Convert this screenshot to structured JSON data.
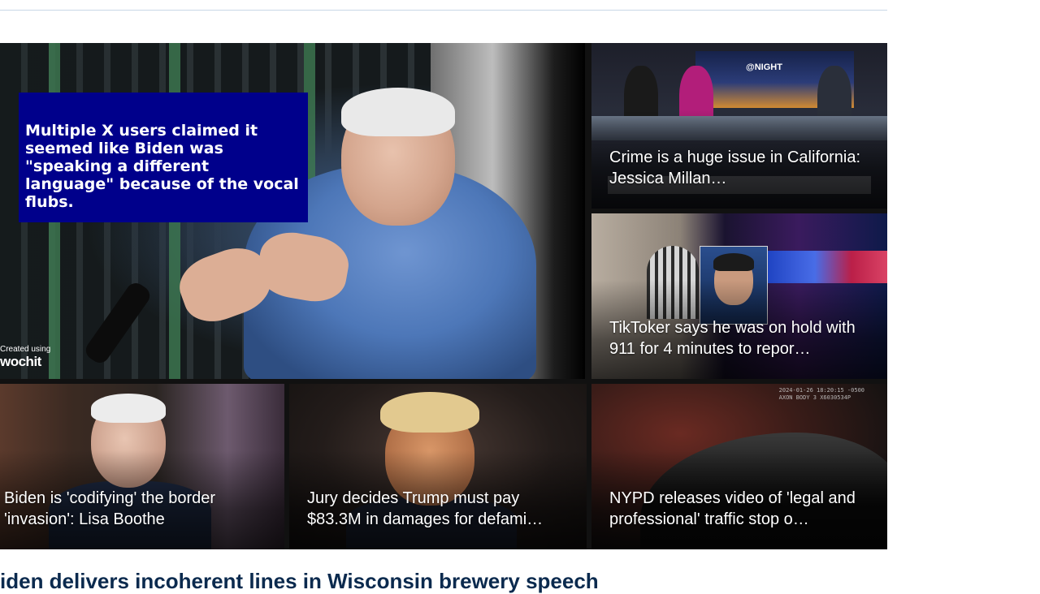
{
  "main_video": {
    "caption": "Multiple X users claimed it seemed like Biden was \"speaking a different language\" because of the vocal flubs.",
    "watermark_small": "Created using",
    "watermark_brand": "wochit"
  },
  "tiles": {
    "crime": {
      "headline": "Crime is a huge issue in California: Jessica Millan…",
      "screen_logo": "@NIGHT"
    },
    "tiktok": {
      "headline": "TikToker says he was on hold with 911 for 4 minutes to repor…"
    },
    "biden": {
      "headline": "Biden is 'codifying' the border 'invasion': Lisa Boothe"
    },
    "trump": {
      "headline": "Jury decides Trump must pay $83.3M in damages for defami…"
    },
    "nypd": {
      "headline": "NYPD releases video of 'legal and professional' traffic stop o…",
      "bodycam_line1": "2024-01-26 18:20:15 -0500",
      "bodycam_line2": "AXON BODY 3 X6030534P"
    }
  },
  "article": {
    "headline": "iden delivers incoherent lines in Wisconsin brewery speech"
  },
  "colors": {
    "caption_box": "#00008b",
    "headline_text": "#0b2a4e",
    "divider": "#c9d7e6"
  }
}
